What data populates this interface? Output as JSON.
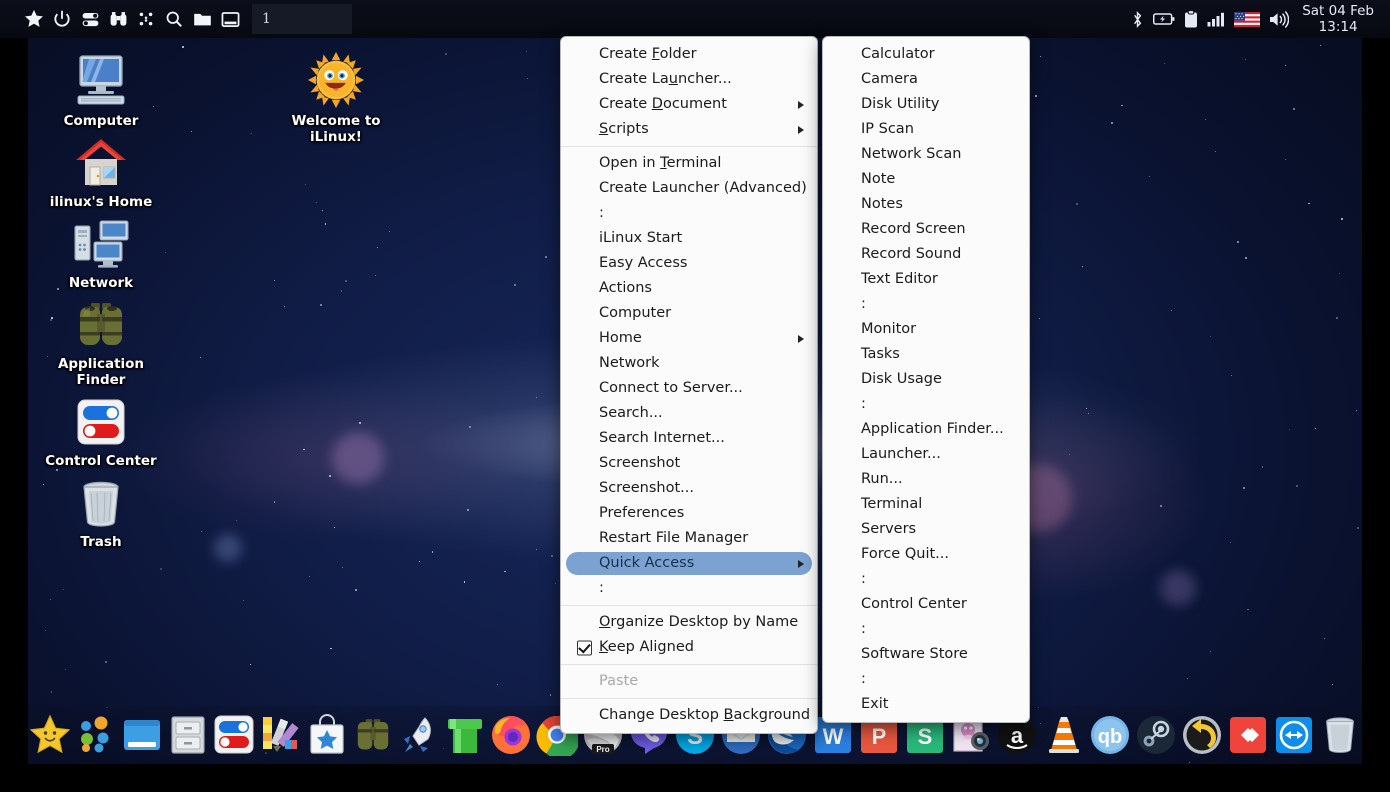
{
  "panel": {
    "launcher_icons": [
      {
        "name": "star-icon",
        "label": "Start"
      },
      {
        "name": "power-icon",
        "label": "Power"
      },
      {
        "name": "toggles-icon",
        "label": "Control Center"
      },
      {
        "name": "binoculars-icon",
        "label": "Application Finder"
      },
      {
        "name": "grid-dots-icon",
        "label": "Applications"
      },
      {
        "name": "search-icon",
        "label": "Search"
      },
      {
        "name": "folder-icon",
        "label": "File Manager"
      },
      {
        "name": "window-icon",
        "label": "Show Desktop"
      }
    ],
    "tasklist": [
      {
        "title": "1"
      }
    ],
    "tray_icons": [
      {
        "name": "bluetooth-icon",
        "label": "Bluetooth"
      },
      {
        "name": "battery-icon",
        "label": "Battery"
      },
      {
        "name": "clipboard-icon",
        "label": "Clipboard"
      },
      {
        "name": "signal-bars-icon",
        "label": "Network Signal"
      },
      {
        "name": "flag-us-icon",
        "label": "Keyboard Layout: US"
      },
      {
        "name": "volume-icon",
        "label": "Volume"
      }
    ],
    "clock": {
      "date": "Sat 04 Feb",
      "time": "13:14"
    }
  },
  "desktop_icons": [
    {
      "label": "Computer",
      "icon": "computer-icon"
    },
    {
      "label_line1": "ilinux's Home",
      "label": "ilinux's Home",
      "icon": "home-icon"
    },
    {
      "label": "Network",
      "icon": "network-icon"
    },
    {
      "label": "Application Finder",
      "label_line1": "Application",
      "label_line2": "Finder",
      "icon": "binoculars-icon"
    },
    {
      "label": "Control Center",
      "icon": "control-center-icon"
    },
    {
      "label": "Trash",
      "icon": "trash-icon"
    },
    {
      "label": "Welcome to iLinux!",
      "label_line1": "Welcome to",
      "label_line2": "iLinux!",
      "icon": "sun-smile-icon"
    }
  ],
  "context_menu": {
    "items": [
      {
        "label": "Create Folder",
        "mnemonic": "F",
        "type": "item"
      },
      {
        "label": "Create Launcher...",
        "mnemonic": "u",
        "type": "item"
      },
      {
        "label": "Create Document",
        "mnemonic": "D",
        "type": "submenu"
      },
      {
        "label": "Scripts",
        "mnemonic": "S",
        "type": "submenu"
      },
      {
        "type": "separator"
      },
      {
        "label": "Open in Terminal",
        "mnemonic": "T",
        "type": "item"
      },
      {
        "label": "Create Launcher (Advanced)",
        "type": "item"
      },
      {
        "label": ":",
        "type": "item"
      },
      {
        "label": "iLinux Start",
        "type": "item"
      },
      {
        "label": "Easy Access",
        "type": "item"
      },
      {
        "label": "Actions",
        "type": "item"
      },
      {
        "label": "Computer",
        "type": "item"
      },
      {
        "label": "Home",
        "type": "submenu"
      },
      {
        "label": "Network",
        "type": "item"
      },
      {
        "label": "Connect to Server...",
        "type": "item"
      },
      {
        "label": "Search...",
        "type": "item"
      },
      {
        "label": "Search Internet...",
        "type": "item"
      },
      {
        "label": "Screenshot",
        "type": "item"
      },
      {
        "label": "Screenshot...",
        "type": "item"
      },
      {
        "label": "Preferences",
        "type": "item"
      },
      {
        "label": "Restart File Manager",
        "type": "item"
      },
      {
        "label": "Quick Access",
        "type": "submenu",
        "selected": true
      },
      {
        "label": ":",
        "type": "item"
      },
      {
        "type": "separator"
      },
      {
        "label": "Organize Desktop by Name",
        "mnemonic": "O",
        "type": "item"
      },
      {
        "label": "Keep Aligned",
        "mnemonic": "K",
        "type": "checkbox",
        "checked": true
      },
      {
        "type": "separator"
      },
      {
        "label": "Paste",
        "type": "item",
        "disabled": true
      },
      {
        "type": "separator"
      },
      {
        "label": "Change Desktop Background",
        "mnemonic": "B",
        "type": "item"
      }
    ]
  },
  "quick_access_submenu": {
    "items": [
      {
        "label": "Calculator",
        "type": "item"
      },
      {
        "label": "Camera",
        "type": "item"
      },
      {
        "label": "Disk Utility",
        "type": "item"
      },
      {
        "label": "IP Scan",
        "type": "item"
      },
      {
        "label": "Network Scan",
        "type": "item"
      },
      {
        "label": "Note",
        "type": "item"
      },
      {
        "label": "Notes",
        "type": "item"
      },
      {
        "label": "Record Screen",
        "type": "item"
      },
      {
        "label": "Record Sound",
        "type": "item"
      },
      {
        "label": "Text Editor",
        "type": "item"
      },
      {
        "label": ":",
        "type": "item"
      },
      {
        "label": "Monitor",
        "type": "item"
      },
      {
        "label": "Tasks",
        "type": "item"
      },
      {
        "label": "Disk Usage",
        "type": "item"
      },
      {
        "label": ":",
        "type": "item"
      },
      {
        "label": "Application Finder...",
        "type": "item"
      },
      {
        "label": "Launcher...",
        "type": "item"
      },
      {
        "label": "Run...",
        "type": "item"
      },
      {
        "label": "Terminal",
        "type": "item"
      },
      {
        "label": "Servers",
        "type": "item"
      },
      {
        "label": "Force Quit...",
        "type": "item"
      },
      {
        "label": ":",
        "type": "item"
      },
      {
        "label": "Control Center",
        "type": "item"
      },
      {
        "label": ":",
        "type": "item"
      },
      {
        "label": "Software Store",
        "type": "item"
      },
      {
        "label": ":",
        "type": "item"
      },
      {
        "label": "Exit",
        "type": "item"
      }
    ]
  },
  "dock": {
    "items": [
      {
        "name": "star-smile-icon",
        "label": "iLinux Start"
      },
      {
        "name": "app-dots-icon",
        "label": "Applications"
      },
      {
        "name": "window-blue-icon",
        "label": "Show Desktop"
      },
      {
        "name": "file-cabinet-icon",
        "label": "File Manager"
      },
      {
        "name": "control-center-icon",
        "label": "Control Center"
      },
      {
        "name": "color-palette-icon",
        "label": "Appearance"
      },
      {
        "name": "software-store-icon",
        "label": "Software Store"
      },
      {
        "name": "binoculars-icon",
        "label": "Application Finder"
      },
      {
        "name": "rocket-icon",
        "label": "Launcher"
      },
      {
        "name": "pipe-icon",
        "label": "Pipe"
      },
      {
        "name": "firefox-icon",
        "label": "Firefox"
      },
      {
        "name": "chrome-icon",
        "label": "Google Chrome"
      },
      {
        "name": "opera-pro-icon",
        "label": "Pro Browser"
      },
      {
        "name": "viber-icon",
        "label": "Viber"
      },
      {
        "name": "skype-icon",
        "label": "Skype"
      },
      {
        "name": "mail-icon",
        "label": "Mail"
      },
      {
        "name": "thunderbird-icon",
        "label": "Thunderbird"
      },
      {
        "name": "writer-icon",
        "label": "Writer"
      },
      {
        "name": "presentation-icon",
        "label": "Presentation"
      },
      {
        "name": "spreadsheet-icon",
        "label": "Spreadsheet"
      },
      {
        "name": "webcam-icon",
        "label": "Camera"
      },
      {
        "name": "amazon-icon",
        "label": "Amazon"
      },
      {
        "name": "vlc-icon",
        "label": "VLC"
      },
      {
        "name": "qbittorrent-icon",
        "label": "qBittorrent"
      },
      {
        "name": "steam-icon",
        "label": "Steam"
      },
      {
        "name": "backup-icon",
        "label": "Backup"
      },
      {
        "name": "anydesk-icon",
        "label": "AnyDesk"
      },
      {
        "name": "teamviewer-icon",
        "label": "TeamViewer"
      },
      {
        "name": "trash-icon",
        "label": "Trash"
      }
    ]
  },
  "colors": {
    "menu_bg": "#fbfbfb",
    "menu_text": "#1b1b1b",
    "menu_highlight": "#7ba2d0",
    "panel_bg": "#0b0e1a",
    "panel_text": "#dfe4ef",
    "desktop_label": "#ffffff"
  }
}
